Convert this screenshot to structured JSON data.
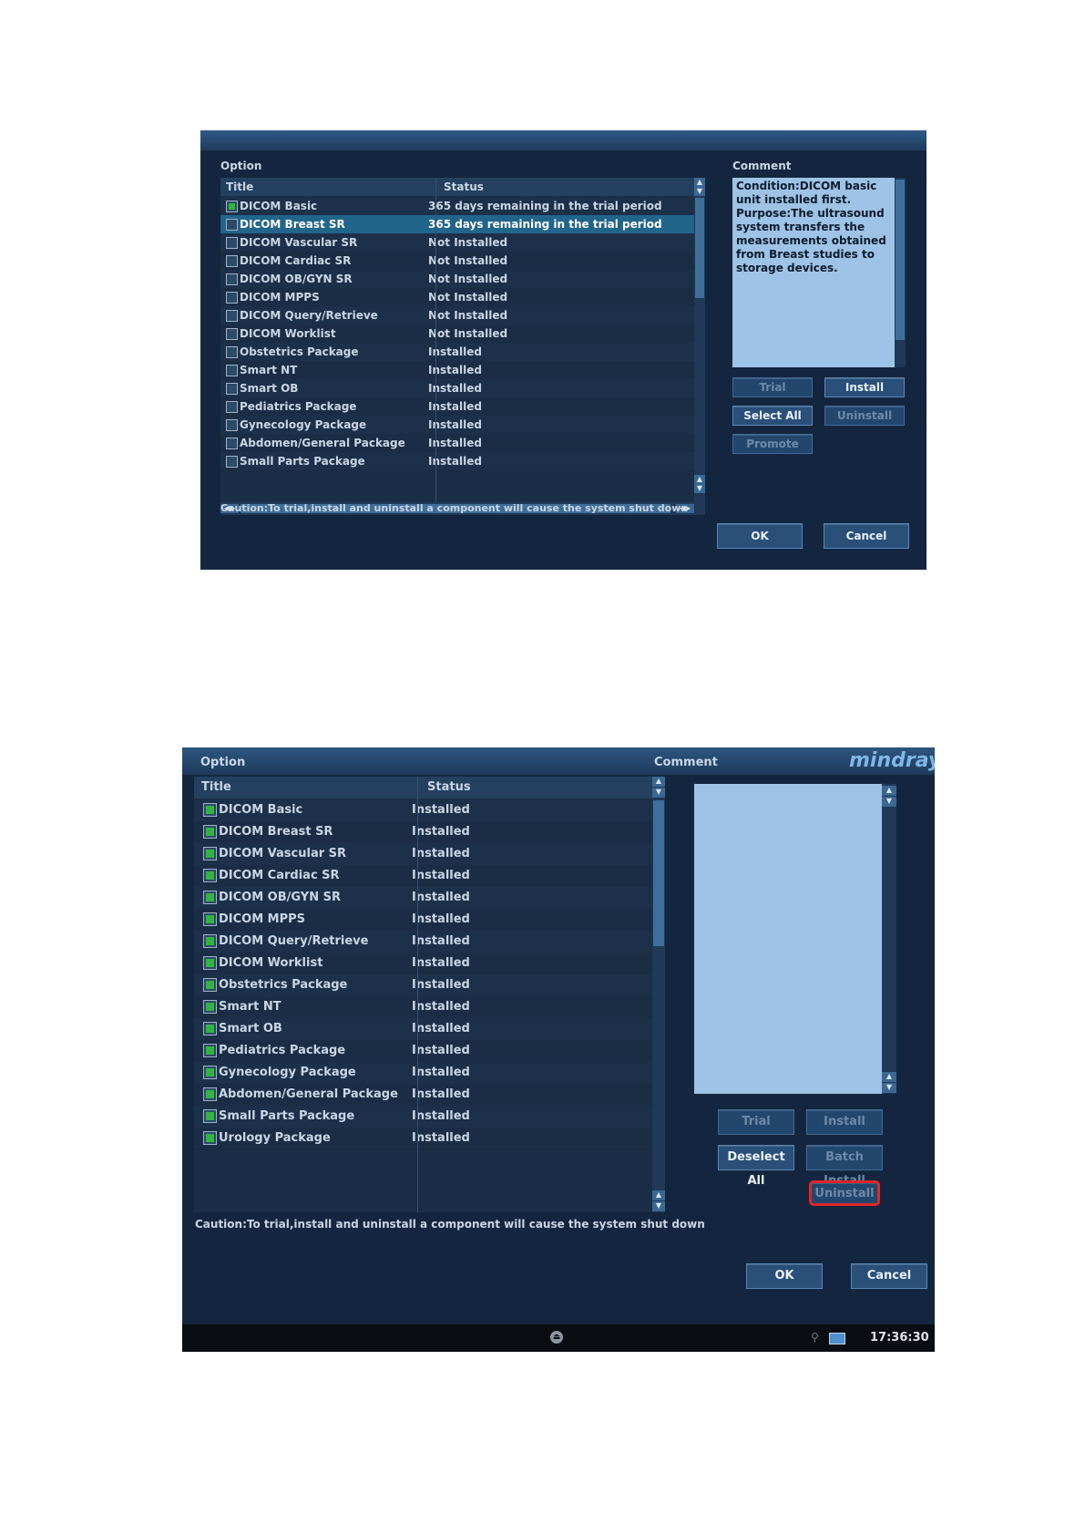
{
  "top": {
    "option_label": "Option",
    "comment_label": "Comment",
    "columns": [
      "Title",
      "Status"
    ],
    "rows": [
      {
        "title": "DICOM Basic",
        "status": "365 days remaining in the trial period",
        "checked": true,
        "selected": false
      },
      {
        "title": "DICOM Breast SR",
        "status": "365 days remaining in the trial period",
        "checked": false,
        "selected": true
      },
      {
        "title": "DICOM Vascular SR",
        "status": "Not Installed",
        "checked": false,
        "selected": false
      },
      {
        "title": "DICOM Cardiac SR",
        "status": "Not Installed",
        "checked": false,
        "selected": false
      },
      {
        "title": "DICOM OB/GYN SR",
        "status": "Not Installed",
        "checked": false,
        "selected": false
      },
      {
        "title": "DICOM MPPS",
        "status": "Not Installed",
        "checked": false,
        "selected": false
      },
      {
        "title": "DICOM Query/Retrieve",
        "status": "Not Installed",
        "checked": false,
        "selected": false
      },
      {
        "title": "DICOM Worklist",
        "status": "Not Installed",
        "checked": false,
        "selected": false
      },
      {
        "title": "Obstetrics Package",
        "status": "Installed",
        "checked": false,
        "selected": false
      },
      {
        "title": "Smart NT",
        "status": "Installed",
        "checked": false,
        "selected": false
      },
      {
        "title": "Smart OB",
        "status": "Installed",
        "checked": false,
        "selected": false
      },
      {
        "title": "Pediatrics Package",
        "status": "Installed",
        "checked": false,
        "selected": false
      },
      {
        "title": "Gynecology Package",
        "status": "Installed",
        "checked": false,
        "selected": false
      },
      {
        "title": "Abdomen/General Package",
        "status": "Installed",
        "checked": false,
        "selected": false
      },
      {
        "title": "Small Parts Package",
        "status": "Installed",
        "checked": false,
        "selected": false
      }
    ],
    "comment_text": "Condition:DICOM basic unit installed first.\nPurpose:The ultrasound system transfers the measurements obtained from Breast studies to storage devices.",
    "buttons": {
      "trial": "Trial",
      "install": "Install",
      "select_all": "Select All",
      "uninstall": "Uninstall",
      "promote": "Promote"
    },
    "caution": "Caution:To trial,install and uninstall a component will cause the system shut down",
    "ok": "OK",
    "cancel": "Cancel"
  },
  "bottom": {
    "option_label": "Option",
    "comment_label": "Comment",
    "brand": "mindray",
    "columns": [
      "Title",
      "Status"
    ],
    "rows": [
      {
        "title": "DICOM Basic",
        "status": "Installed"
      },
      {
        "title": "DICOM Breast SR",
        "status": "Installed"
      },
      {
        "title": "DICOM Vascular SR",
        "status": "Installed"
      },
      {
        "title": "DICOM Cardiac SR",
        "status": "Installed"
      },
      {
        "title": "DICOM OB/GYN SR",
        "status": "Installed"
      },
      {
        "title": "DICOM MPPS",
        "status": "Installed"
      },
      {
        "title": "DICOM Query/Retrieve",
        "status": "Installed"
      },
      {
        "title": "DICOM Worklist",
        "status": "Installed"
      },
      {
        "title": "Obstetrics Package",
        "status": "Installed"
      },
      {
        "title": "Smart NT",
        "status": "Installed"
      },
      {
        "title": "Smart OB",
        "status": "Installed"
      },
      {
        "title": "Pediatrics Package",
        "status": "Installed"
      },
      {
        "title": "Gynecology Package",
        "status": "Installed"
      },
      {
        "title": "Abdomen/General Package",
        "status": "Installed"
      },
      {
        "title": "Small Parts Package",
        "status": "Installed"
      },
      {
        "title": "Urology Package",
        "status": "Installed"
      }
    ],
    "buttons": {
      "trial": "Trial",
      "install": "Install",
      "deselect_all": "Deselect All",
      "batch_install": "Batch Install",
      "uninstall": "Uninstall"
    },
    "caution": "Caution:To trial,install and uninstall a component will cause the system shut down",
    "ok": "OK",
    "cancel": "Cancel",
    "clock": "17:36:30"
  },
  "colors": {
    "panel": "#14263f",
    "selected_row": "#21658a",
    "comment_bg": "#9ec3e6",
    "checkbox_on": "#32b443",
    "highlight_outline": "#e0262a"
  },
  "icons": [
    "checkbox-icon",
    "scroll-up-icon",
    "scroll-down-icon",
    "scroll-left-icon",
    "scroll-right-icon",
    "eject-icon",
    "network-icon",
    "monitor-icon"
  ]
}
